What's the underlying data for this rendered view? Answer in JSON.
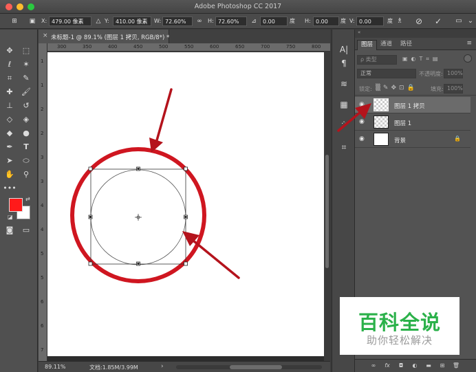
{
  "window": {
    "title": "Adobe Photoshop CC 2017",
    "traffic_lights": [
      "#fc5f57",
      "#fdbc2e",
      "#2ac940"
    ]
  },
  "options_bar": {
    "x_label": "X:",
    "x_value": "479.00 像素",
    "y_label": "Y:",
    "y_value": "410.00 像素",
    "w_label": "W:",
    "w_value": "72.60%",
    "h_label": "H:",
    "h_value": "72.60%",
    "angle_value": "0.00",
    "angle_unit": "度",
    "hskew_label": "H:",
    "hskew_value": "0.00",
    "hskew_unit": "度",
    "vskew_label": "V:",
    "vskew_value": "0.00",
    "vskew_unit": "度"
  },
  "document_tab": {
    "label": "未标题-1 @ 89.1% (图层 1 拷贝, RGB/8*) *",
    "close_glyph": "×"
  },
  "rulers": {
    "h_ticks": [
      "300",
      "350",
      "400",
      "450",
      "500",
      "550",
      "600",
      "650",
      "700",
      "750",
      "800"
    ],
    "v_ticks": [
      "1",
      "1",
      "2",
      "2",
      "3",
      "3",
      "4",
      "4",
      "5",
      "5",
      "6",
      "6",
      "7",
      "7"
    ]
  },
  "status_bar": {
    "zoom": "89.11%",
    "doc_info": "文档:1.85M/3.99M"
  },
  "colors": {
    "foreground": "#ff1a1a",
    "background": "#ffffff",
    "annotation_red": "#c8141e"
  },
  "layers_panel": {
    "tabs": [
      "图层",
      "通道",
      "路径"
    ],
    "filter_placeholder": "ρ 类型",
    "blend_mode": "正常",
    "opacity_label": "不透明度:",
    "opacity_value": "100%",
    "lock_label": "锁定:",
    "fill_label": "填充:",
    "fill_value": "100%",
    "layers": [
      {
        "name": "图层 1 拷贝",
        "selected": true,
        "visible_icon": "eye-icon"
      },
      {
        "name": "图层 1",
        "selected": false,
        "visible_icon": "eye-icon"
      },
      {
        "name": "背景",
        "selected": false,
        "visible_icon": "eye-icon",
        "locked_icon": "lock-icon"
      }
    ],
    "footer_icons": [
      "link-icon",
      "fx-icon",
      "mask-icon",
      "adjustment-icon",
      "folder-icon",
      "new-layer-icon",
      "trash-icon"
    ]
  },
  "watermark": {
    "title": "百科全说",
    "subtitle": "助你轻松解决"
  }
}
